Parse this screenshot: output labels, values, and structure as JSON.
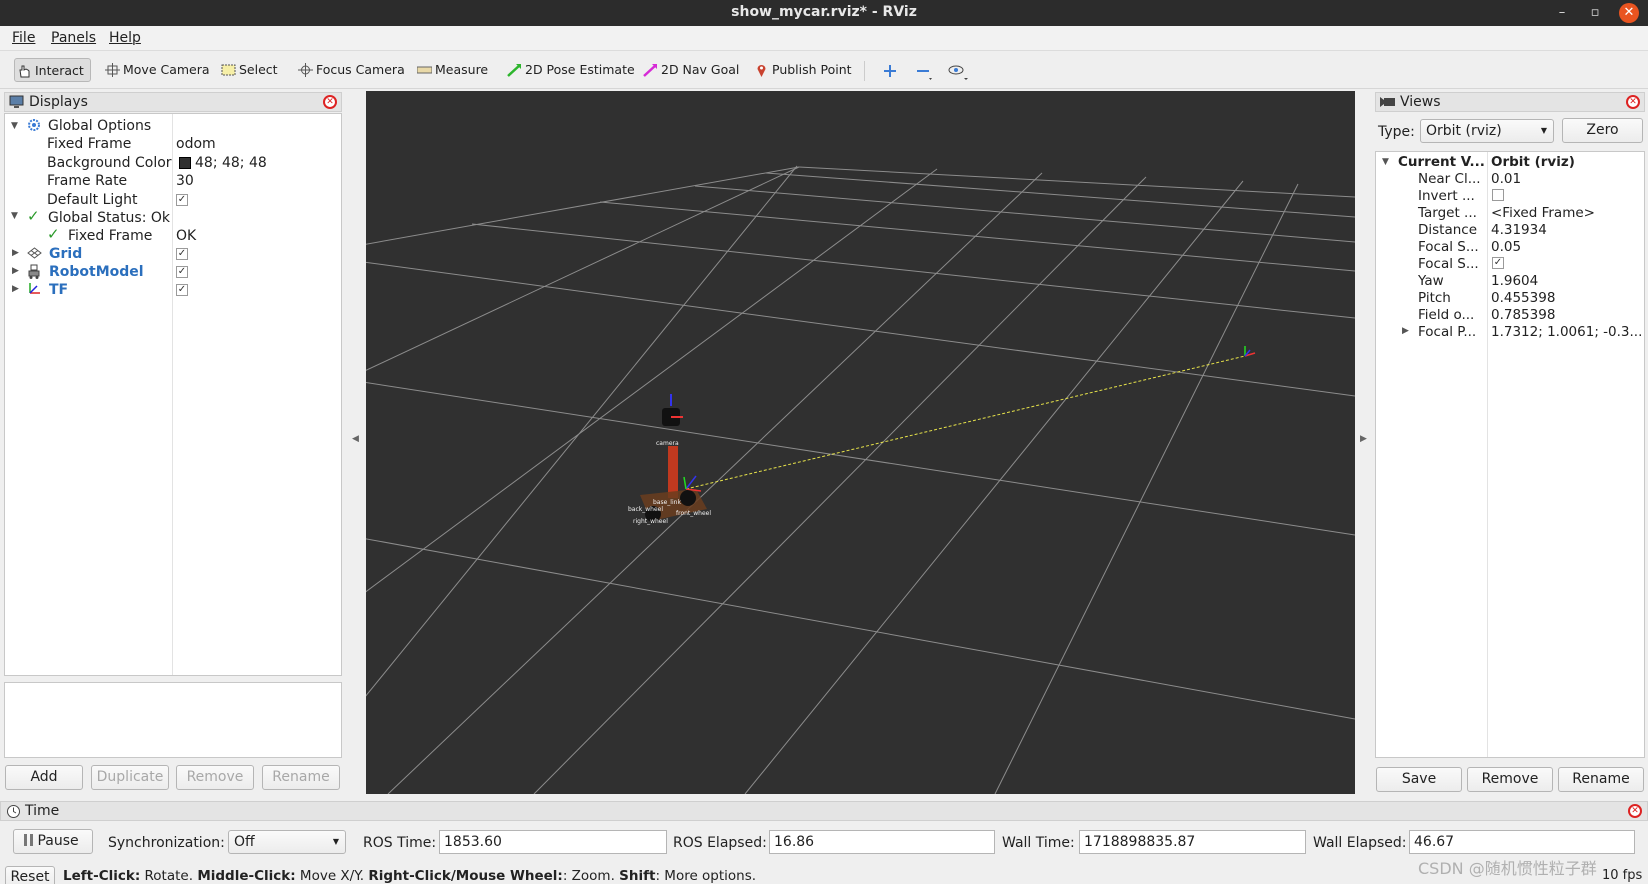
{
  "window": {
    "title": "show_mycar.rviz* - RViz",
    "minimize": "–",
    "maximize": "▫",
    "close": "✕"
  },
  "menu": {
    "file": "File",
    "panels": "Panels",
    "help": "Help"
  },
  "toolbar": {
    "interact": "Interact",
    "move_camera": "Move Camera",
    "select": "Select",
    "focus_camera": "Focus Camera",
    "measure": "Measure",
    "pose_estimate": "2D Pose Estimate",
    "nav_goal": "2D Nav Goal",
    "publish_point": "Publish Point"
  },
  "displays": {
    "title": "Displays",
    "global_options": "Global Options",
    "fixed_frame_label": "Fixed Frame",
    "fixed_frame_value": "odom",
    "bg_color_label": "Background Color",
    "bg_color_value": "48; 48; 48",
    "bg_color_hex": "#303030",
    "frame_rate_label": "Frame Rate",
    "frame_rate_value": "30",
    "default_light_label": "Default Light",
    "default_light_checked": true,
    "global_status": "Global Status: Ok",
    "status_fixed_frame": "Fixed Frame",
    "status_fixed_frame_value": "OK",
    "items": [
      {
        "label": "Grid",
        "icon": "grid-icon",
        "checked": true
      },
      {
        "label": "RobotModel",
        "icon": "robot-icon",
        "checked": true
      },
      {
        "label": "TF",
        "icon": "tf-icon",
        "checked": true
      }
    ],
    "buttons": {
      "add": "Add",
      "duplicate": "Duplicate",
      "remove": "Remove",
      "rename": "Rename"
    }
  },
  "views": {
    "title": "Views",
    "type_label": "Type:",
    "type_value": "Orbit (rviz)",
    "zero": "Zero",
    "current_label": "Current V...",
    "current_value": "Orbit (rviz)",
    "props": [
      {
        "name": "Near Cl...",
        "value": "0.01"
      },
      {
        "name": "Invert ...",
        "value": ""
      },
      {
        "name": "Target ...",
        "value": "<Fixed Frame>"
      },
      {
        "name": "Distance",
        "value": "4.31934"
      },
      {
        "name": "Focal S...",
        "value": "0.05"
      },
      {
        "name": "Focal S...",
        "value": ""
      },
      {
        "name": "Yaw",
        "value": "1.9604"
      },
      {
        "name": "Pitch",
        "value": "0.455398"
      },
      {
        "name": "Field o...",
        "value": "0.785398"
      },
      {
        "name": "Focal P...",
        "value": "1.7312; 1.0061; -0.3..."
      }
    ],
    "buttons": {
      "save": "Save",
      "remove": "Remove",
      "rename": "Rename"
    }
  },
  "viewport": {
    "frame_labels": [
      "camera",
      "base_link",
      "back_wheel",
      "right_wheel",
      "front_wheel"
    ]
  },
  "time": {
    "title": "Time",
    "pause": "Pause",
    "sync_label": "Synchronization:",
    "sync_value": "Off",
    "ros_time_label": "ROS Time:",
    "ros_time": "1853.60",
    "ros_elapsed_label": "ROS Elapsed:",
    "ros_elapsed": "16.86",
    "wall_time_label": "Wall Time:",
    "wall_time": "1718898835.87",
    "wall_elapsed_label": "Wall Elapsed:",
    "wall_elapsed": "46.67"
  },
  "status": {
    "reset": "Reset",
    "b1": "Left-Click:",
    "t1": " Rotate. ",
    "b2": "Middle-Click:",
    "t2": " Move X/Y. ",
    "b3": "Right-Click/Mouse Wheel:",
    "t3": ": Zoom. ",
    "b4": "Shift",
    "t4": ": More options.",
    "fps": "10 fps",
    "watermark": "CSDN @随机惯性粒子群"
  }
}
